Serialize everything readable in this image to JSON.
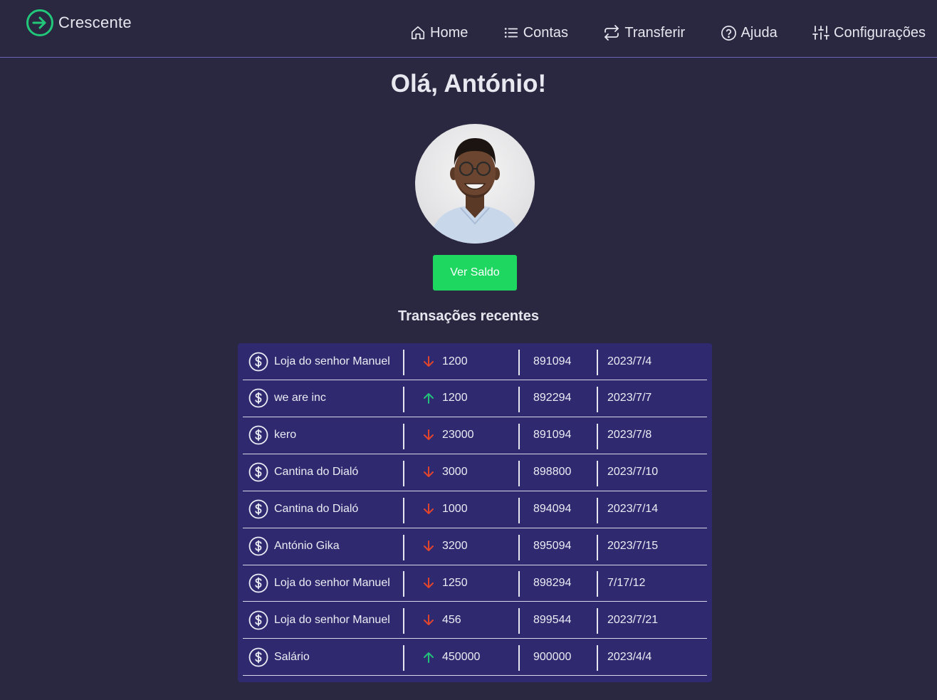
{
  "brand": {
    "name": "Crescente",
    "color": "#21c87a"
  },
  "nav": [
    {
      "label": "Home",
      "icon": "home-icon"
    },
    {
      "label": "Contas",
      "icon": "list-icon"
    },
    {
      "label": "Transferir",
      "icon": "repeat-icon"
    },
    {
      "label": "Ajuda",
      "icon": "help-circle-icon"
    },
    {
      "label": "Configurações",
      "icon": "sliders-icon"
    }
  ],
  "greeting": "Olá, António!",
  "avatar": {
    "icon": "user-photo"
  },
  "balance_button": "Ver Saldo",
  "transactions_title": "Transações recentes",
  "colors": {
    "accent": "#1ed760",
    "down": "#e2452c",
    "up": "#23c07a",
    "card": "#2f2a70",
    "background": "#2a2840"
  },
  "transactions": [
    {
      "name": "Loja do senhor Manuel",
      "direction": "down",
      "amount": "1200",
      "ref": "891094",
      "date": "2023/7/4"
    },
    {
      "name": "we are inc",
      "direction": "up",
      "amount": "1200",
      "ref": "892294",
      "date": "2023/7/7"
    },
    {
      "name": "kero",
      "direction": "down",
      "amount": "23000",
      "ref": "891094",
      "date": "2023/7/8"
    },
    {
      "name": "Cantina do Dialó",
      "direction": "down",
      "amount": "3000",
      "ref": "898800",
      "date": "2023/7/10"
    },
    {
      "name": "Cantina do Dialó",
      "direction": "down",
      "amount": "1000",
      "ref": "894094",
      "date": "2023/7/14"
    },
    {
      "name": "António Gika",
      "direction": "down",
      "amount": "3200",
      "ref": "895094",
      "date": "2023/7/15"
    },
    {
      "name": "Loja do senhor Manuel",
      "direction": "down",
      "amount": "1250",
      "ref": "898294",
      "date": "7/17/12"
    },
    {
      "name": "Loja do senhor Manuel",
      "direction": "down",
      "amount": "456",
      "ref": "899544",
      "date": "2023/7/21"
    },
    {
      "name": "Salário",
      "direction": "up",
      "amount": "450000",
      "ref": "900000",
      "date": "2023/4/4"
    }
  ]
}
